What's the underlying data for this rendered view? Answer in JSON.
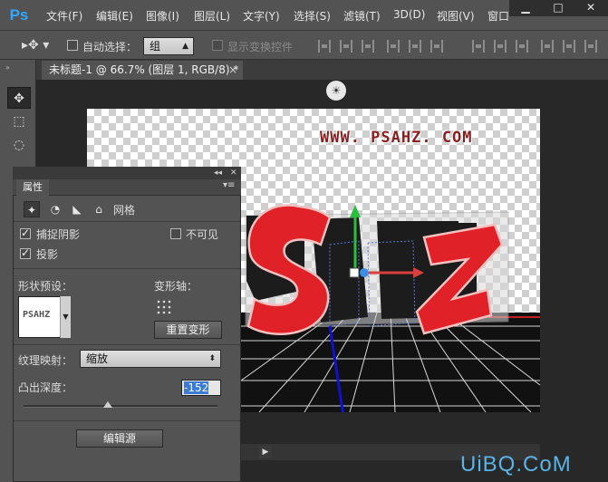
{
  "app": {
    "logo": "Ps"
  },
  "menu": [
    "文件(F)",
    "编辑(E)",
    "图像(I)",
    "图层(L)",
    "文字(Y)",
    "选择(S)",
    "滤镜(T)",
    "3D(D)",
    "视图(V)",
    "窗口"
  ],
  "window_controls": {
    "minimize": "▁",
    "maximize": "□",
    "close": "✕"
  },
  "options": {
    "auto_select_label": "自动选择：",
    "auto_select_value": "组",
    "transform_label": "显示变换控件"
  },
  "document": {
    "tab_title": "未标题-1 @ 66.7% (图层 1, RGB/8) *",
    "close": "×"
  },
  "canvas": {
    "watermark_text": "WWW. PSAHZ. COM"
  },
  "tools": [
    {
      "icon": "move-tool-icon",
      "glyph": "✥"
    },
    {
      "icon": "marquee-tool-icon",
      "glyph": "⬚"
    },
    {
      "icon": "lasso-tool-icon",
      "glyph": "◌"
    }
  ],
  "properties": {
    "panel_tab": "属性",
    "mesh_label": "网格",
    "capture_shadow": {
      "label": "捕捉阴影",
      "checked": true
    },
    "invisible": {
      "label": "不可见",
      "checked": false
    },
    "cast_shadow": {
      "label": "投影",
      "checked": true
    },
    "shape_preset_label": "形状预设：",
    "deform_axis_label": "变形轴：",
    "reset_deform_label": "重置变形",
    "texture_mapping_label": "纹理映射：",
    "texture_mapping_value": "缩放",
    "extrusion_depth_label": "凸出深度：",
    "extrusion_depth_value": "-152",
    "edit_source_label": "编辑源",
    "preset_thumb_text": "PSAHZ"
  },
  "site_watermark": "UiBQ.CoM",
  "colors": {
    "accent_blue": "#31a8ff",
    "letter_red": "#e02127",
    "watermark_blue": "#5ab3e8"
  }
}
